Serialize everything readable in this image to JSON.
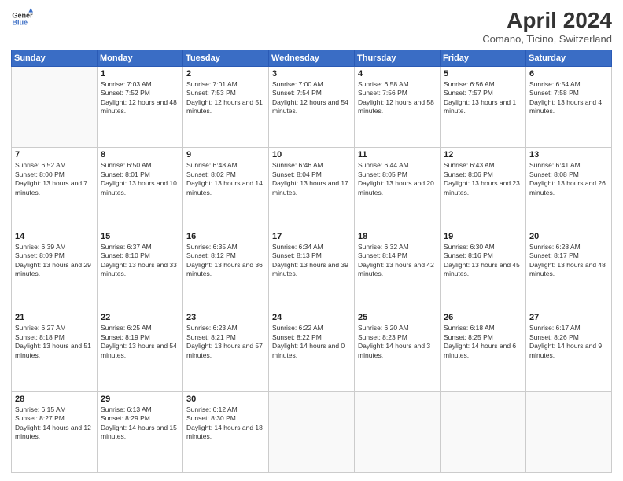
{
  "header": {
    "logo_line1": "General",
    "logo_line2": "Blue",
    "title": "April 2024",
    "location": "Comano, Ticino, Switzerland"
  },
  "weekdays": [
    "Sunday",
    "Monday",
    "Tuesday",
    "Wednesday",
    "Thursday",
    "Friday",
    "Saturday"
  ],
  "weeks": [
    [
      {
        "day": "",
        "sunrise": "",
        "sunset": "",
        "daylight": ""
      },
      {
        "day": "1",
        "sunrise": "7:03 AM",
        "sunset": "7:52 PM",
        "daylight": "12 hours and 48 minutes."
      },
      {
        "day": "2",
        "sunrise": "7:01 AM",
        "sunset": "7:53 PM",
        "daylight": "12 hours and 51 minutes."
      },
      {
        "day": "3",
        "sunrise": "7:00 AM",
        "sunset": "7:54 PM",
        "daylight": "12 hours and 54 minutes."
      },
      {
        "day": "4",
        "sunrise": "6:58 AM",
        "sunset": "7:56 PM",
        "daylight": "12 hours and 58 minutes."
      },
      {
        "day": "5",
        "sunrise": "6:56 AM",
        "sunset": "7:57 PM",
        "daylight": "13 hours and 1 minute."
      },
      {
        "day": "6",
        "sunrise": "6:54 AM",
        "sunset": "7:58 PM",
        "daylight": "13 hours and 4 minutes."
      }
    ],
    [
      {
        "day": "7",
        "sunrise": "6:52 AM",
        "sunset": "8:00 PM",
        "daylight": "13 hours and 7 minutes."
      },
      {
        "day": "8",
        "sunrise": "6:50 AM",
        "sunset": "8:01 PM",
        "daylight": "13 hours and 10 minutes."
      },
      {
        "day": "9",
        "sunrise": "6:48 AM",
        "sunset": "8:02 PM",
        "daylight": "13 hours and 14 minutes."
      },
      {
        "day": "10",
        "sunrise": "6:46 AM",
        "sunset": "8:04 PM",
        "daylight": "13 hours and 17 minutes."
      },
      {
        "day": "11",
        "sunrise": "6:44 AM",
        "sunset": "8:05 PM",
        "daylight": "13 hours and 20 minutes."
      },
      {
        "day": "12",
        "sunrise": "6:43 AM",
        "sunset": "8:06 PM",
        "daylight": "13 hours and 23 minutes."
      },
      {
        "day": "13",
        "sunrise": "6:41 AM",
        "sunset": "8:08 PM",
        "daylight": "13 hours and 26 minutes."
      }
    ],
    [
      {
        "day": "14",
        "sunrise": "6:39 AM",
        "sunset": "8:09 PM",
        "daylight": "13 hours and 29 minutes."
      },
      {
        "day": "15",
        "sunrise": "6:37 AM",
        "sunset": "8:10 PM",
        "daylight": "13 hours and 33 minutes."
      },
      {
        "day": "16",
        "sunrise": "6:35 AM",
        "sunset": "8:12 PM",
        "daylight": "13 hours and 36 minutes."
      },
      {
        "day": "17",
        "sunrise": "6:34 AM",
        "sunset": "8:13 PM",
        "daylight": "13 hours and 39 minutes."
      },
      {
        "day": "18",
        "sunrise": "6:32 AM",
        "sunset": "8:14 PM",
        "daylight": "13 hours and 42 minutes."
      },
      {
        "day": "19",
        "sunrise": "6:30 AM",
        "sunset": "8:16 PM",
        "daylight": "13 hours and 45 minutes."
      },
      {
        "day": "20",
        "sunrise": "6:28 AM",
        "sunset": "8:17 PM",
        "daylight": "13 hours and 48 minutes."
      }
    ],
    [
      {
        "day": "21",
        "sunrise": "6:27 AM",
        "sunset": "8:18 PM",
        "daylight": "13 hours and 51 minutes."
      },
      {
        "day": "22",
        "sunrise": "6:25 AM",
        "sunset": "8:19 PM",
        "daylight": "13 hours and 54 minutes."
      },
      {
        "day": "23",
        "sunrise": "6:23 AM",
        "sunset": "8:21 PM",
        "daylight": "13 hours and 57 minutes."
      },
      {
        "day": "24",
        "sunrise": "6:22 AM",
        "sunset": "8:22 PM",
        "daylight": "14 hours and 0 minutes."
      },
      {
        "day": "25",
        "sunrise": "6:20 AM",
        "sunset": "8:23 PM",
        "daylight": "14 hours and 3 minutes."
      },
      {
        "day": "26",
        "sunrise": "6:18 AM",
        "sunset": "8:25 PM",
        "daylight": "14 hours and 6 minutes."
      },
      {
        "day": "27",
        "sunrise": "6:17 AM",
        "sunset": "8:26 PM",
        "daylight": "14 hours and 9 minutes."
      }
    ],
    [
      {
        "day": "28",
        "sunrise": "6:15 AM",
        "sunset": "8:27 PM",
        "daylight": "14 hours and 12 minutes."
      },
      {
        "day": "29",
        "sunrise": "6:13 AM",
        "sunset": "8:29 PM",
        "daylight": "14 hours and 15 minutes."
      },
      {
        "day": "30",
        "sunrise": "6:12 AM",
        "sunset": "8:30 PM",
        "daylight": "14 hours and 18 minutes."
      },
      {
        "day": "",
        "sunrise": "",
        "sunset": "",
        "daylight": ""
      },
      {
        "day": "",
        "sunrise": "",
        "sunset": "",
        "daylight": ""
      },
      {
        "day": "",
        "sunrise": "",
        "sunset": "",
        "daylight": ""
      },
      {
        "day": "",
        "sunrise": "",
        "sunset": "",
        "daylight": ""
      }
    ]
  ]
}
